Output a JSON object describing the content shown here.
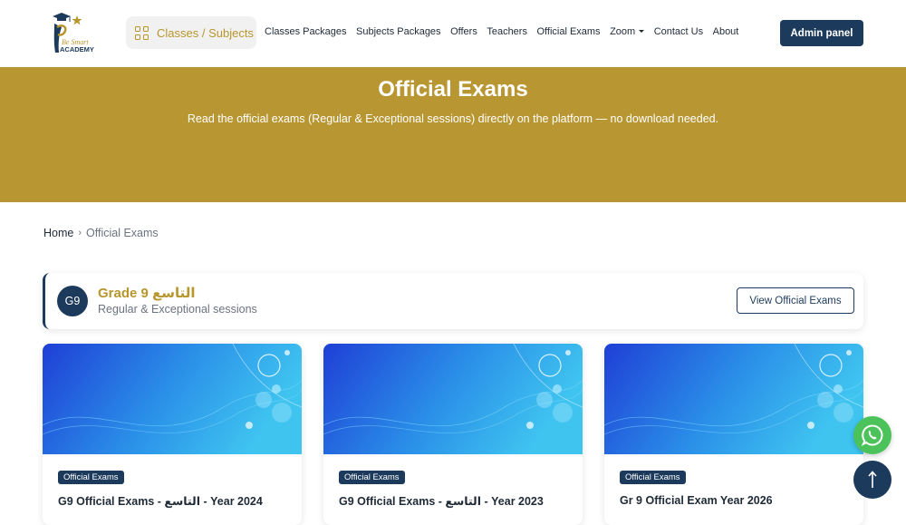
{
  "nav": {
    "logo_text": "Be Smart ACADEMY",
    "classes_label": "Classes / Subjects",
    "links": [
      "Classes Packages",
      "Subjects Packages",
      "Offers",
      "Teachers",
      "Official Exams",
      "Zoom",
      "Contact Us",
      "About"
    ],
    "admin_label": "Admin panel"
  },
  "hero": {
    "title": "Official Exams",
    "subtitle": "Read the official exams (Regular & Exceptional sessions) directly on the platform — no download needed."
  },
  "breadcrumb": {
    "home": "Home",
    "current": "Official Exams"
  },
  "grade": {
    "badge": "G9",
    "title": "Grade 9 التاسع",
    "subtitle": "Regular & Exceptional sessions",
    "button": "View Official Exams"
  },
  "cards": [
    {
      "tag": "Official Exams",
      "title": "G9 Official Exams - التاسع - Year 2024"
    },
    {
      "tag": "Official Exams",
      "title": "G9 Official Exams - التاسع - Year 2023"
    },
    {
      "tag": "Official Exams",
      "title": "Gr 9 Official Exam Year 2026"
    }
  ],
  "icons": {
    "classes": "grid-icon",
    "breadcrumb_separator": "chevron-right-icon",
    "whatsapp": "whatsapp-icon",
    "scroll_top": "arrow-up-icon"
  },
  "colors": {
    "brand_gold": "#b89632",
    "brand_navy": "#1c3a5b",
    "whatsapp_green": "#4bc35a"
  }
}
